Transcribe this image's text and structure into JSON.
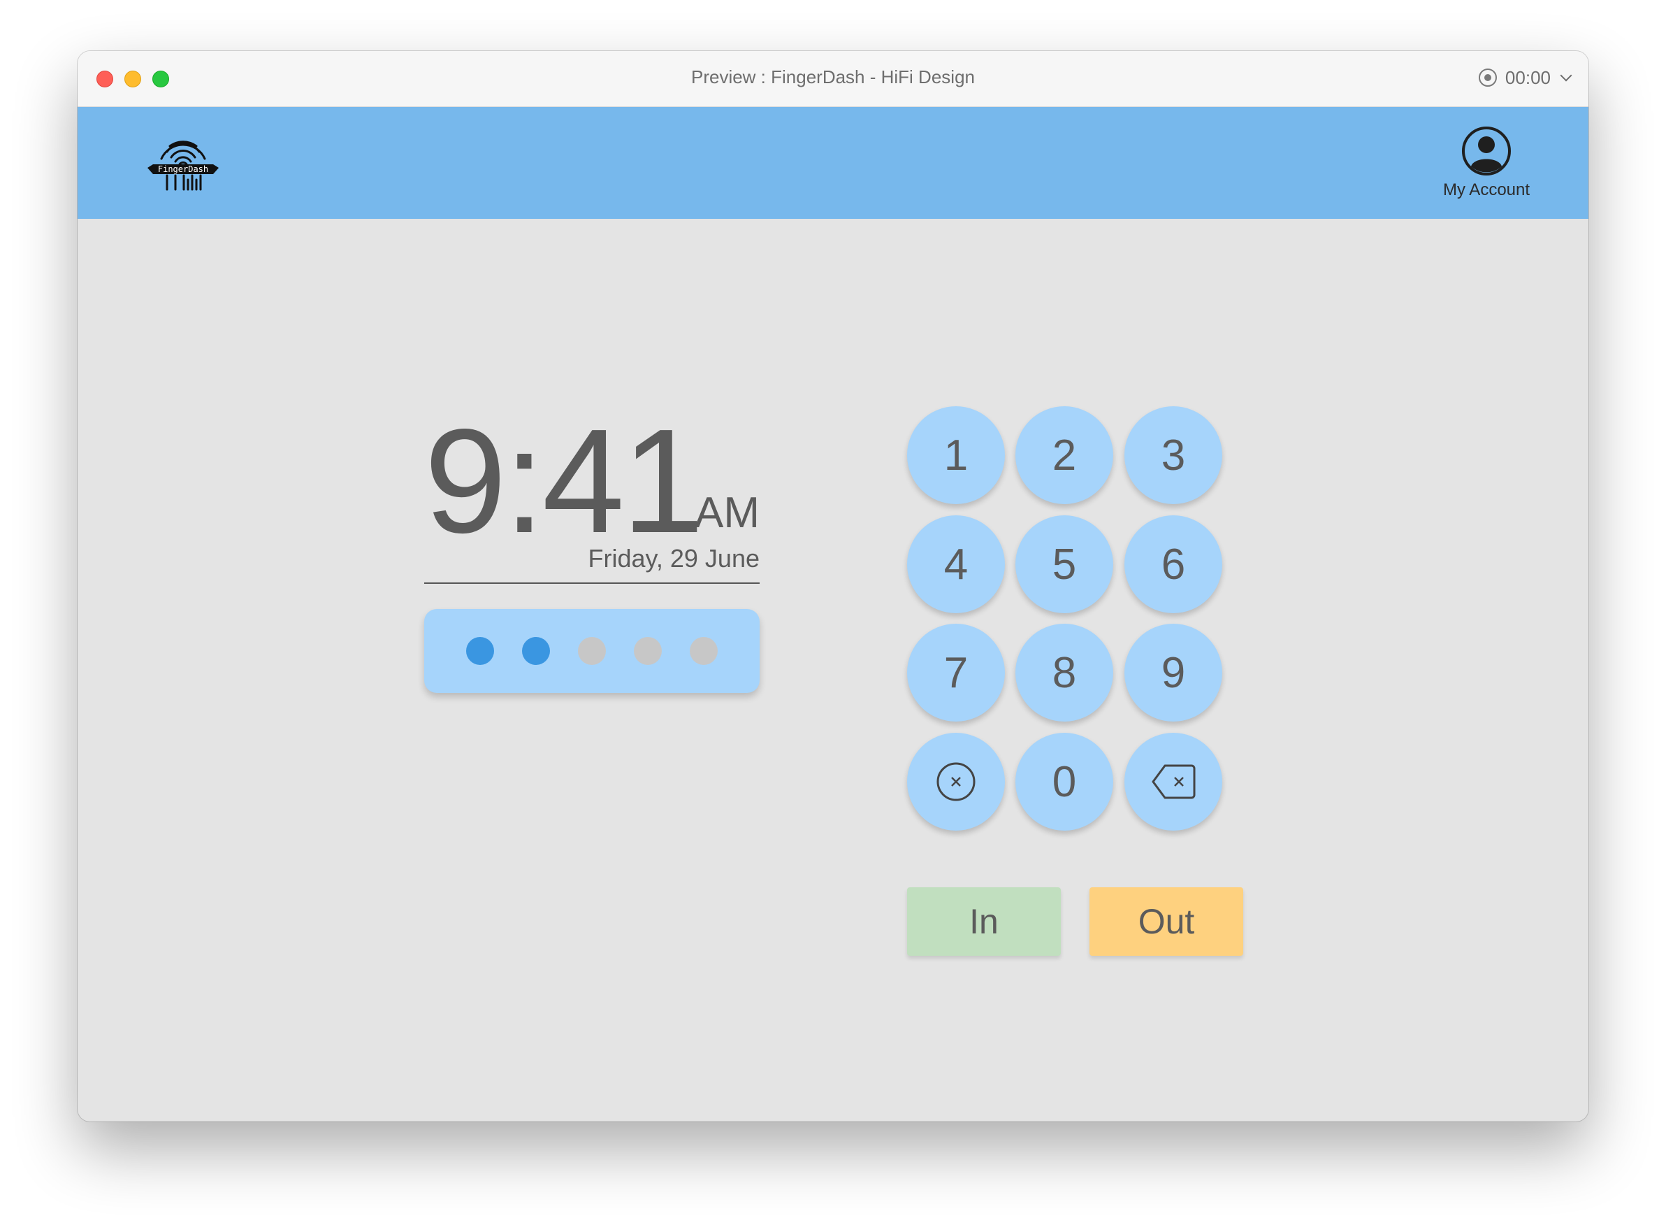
{
  "window": {
    "title": "Preview : FingerDash - HiFi Design",
    "recorder_time": "00:00"
  },
  "header": {
    "logo_text": "FingerDash",
    "account_label": "My Account"
  },
  "clock": {
    "time": "9:41",
    "ampm": "AM",
    "date": "Friday, 29 June"
  },
  "pin": {
    "length": 5,
    "entered": 2
  },
  "keypad": {
    "keys": [
      "1",
      "2",
      "3",
      "4",
      "5",
      "6",
      "7",
      "8",
      "9",
      "0"
    ]
  },
  "actions": {
    "in_label": "In",
    "out_label": "Out"
  },
  "colors": {
    "header": "#77b8ec",
    "key": "#a6d4fb",
    "pin_filled": "#3a96e1",
    "pin_empty": "#c7c7c7",
    "in_button": "#c1dfbf",
    "out_button": "#fed17f"
  },
  "icons": {
    "logo": "fingerprint-icon",
    "account": "user-circle-icon",
    "clear": "clear-circle-x-icon",
    "backspace": "backspace-icon",
    "recorder": "record-icon",
    "dropdown": "chevron-down-icon"
  }
}
